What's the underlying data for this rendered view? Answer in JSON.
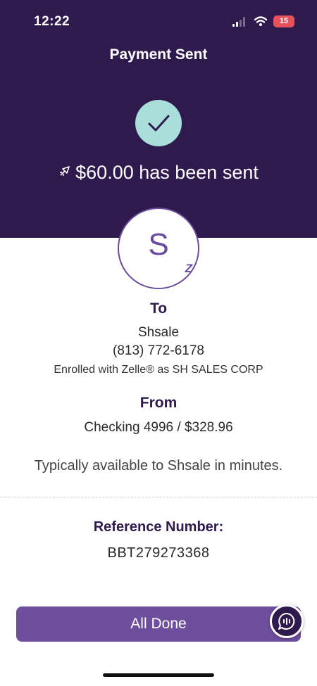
{
  "status_bar": {
    "time": "12:22",
    "battery": "15"
  },
  "header": {
    "title": "Payment Sent"
  },
  "hero": {
    "sent_message": "$60.00 has been sent"
  },
  "recipient": {
    "avatar_letter": "S",
    "zelle_mark": "Z",
    "to_label": "To",
    "name": "Shsale",
    "phone": "(813) 772-6178",
    "enrolled": "Enrolled with Zelle® as SH SALES CORP"
  },
  "source": {
    "from_label": "From",
    "account": "Checking 4996 / $328.96",
    "availability": "Typically available to Shsale in minutes."
  },
  "reference": {
    "label": "Reference Number:",
    "value": "BBT279273368"
  },
  "actions": {
    "done_label": "All Done"
  },
  "colors": {
    "brand_dark": "#2f1a4d",
    "brand_purple": "#6e4f9e",
    "check_teal": "#a9dedb"
  },
  "icons": [
    "signal-icon",
    "wifi-icon",
    "battery-icon",
    "check-icon",
    "rocket-icon",
    "zelle-icon",
    "chat-icon"
  ]
}
